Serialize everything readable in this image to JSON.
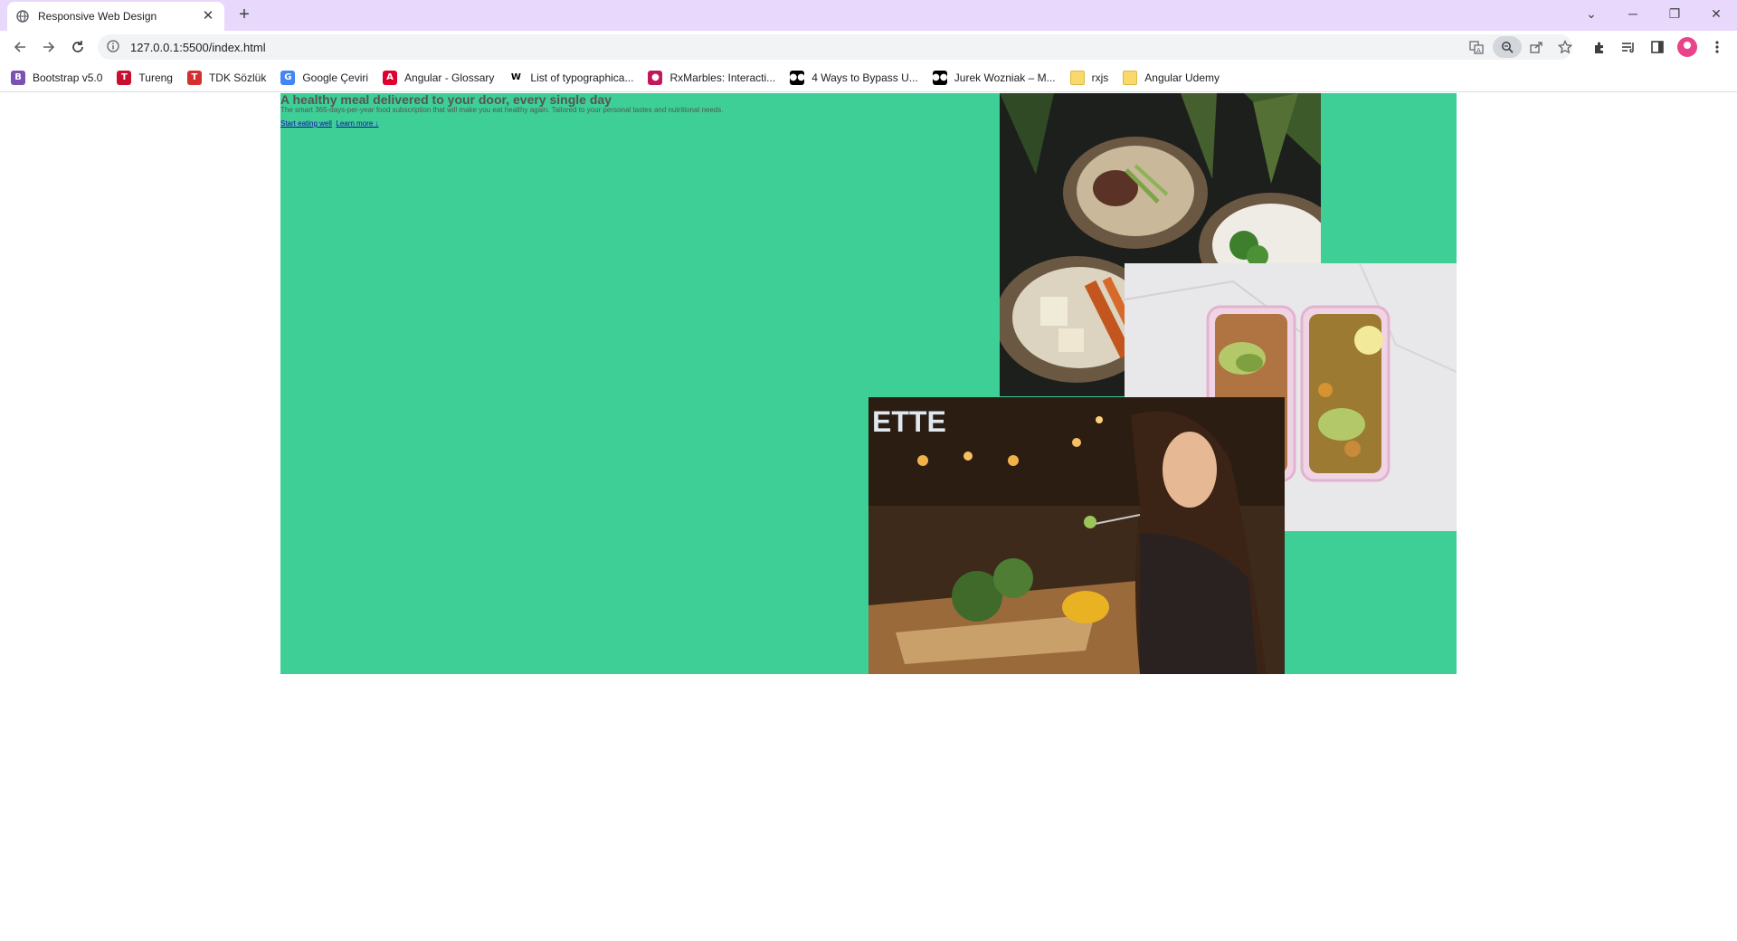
{
  "browser": {
    "tab_title": "Responsive Web Design",
    "url": "127.0.0.1:5500/index.html",
    "bookmarks": [
      {
        "label": "Bootstrap v5.0",
        "icon": "bootstrap-icon",
        "color": "#7952b3",
        "glyph": "B"
      },
      {
        "label": "Tureng",
        "icon": "tureng-icon",
        "color": "#c8102e",
        "glyph": "T"
      },
      {
        "label": "TDK Sözlük",
        "icon": "tdk-icon",
        "color": "#d32f2f",
        "glyph": "T"
      },
      {
        "label": "Google Çeviri",
        "icon": "google-translate-icon",
        "color": "#4285f4",
        "glyph": "G"
      },
      {
        "label": "Angular - Glossary",
        "icon": "angular-icon",
        "color": "#dd0031",
        "glyph": "A"
      },
      {
        "label": "List of typographica...",
        "icon": "wikipedia-icon",
        "color": "#ffffff",
        "glyph": "W"
      },
      {
        "label": "RxMarbles: Interacti...",
        "icon": "rxmarbles-icon",
        "color": "#c2185b",
        "glyph": "●"
      },
      {
        "label": "4 Ways to Bypass U...",
        "icon": "medium-icon",
        "color": "#000000",
        "glyph": "●●"
      },
      {
        "label": "Jurek Wozniak – M...",
        "icon": "medium-icon",
        "color": "#000000",
        "glyph": "●●"
      },
      {
        "label": "rxjs",
        "icon": "folder-icon",
        "color": "#f9d96b",
        "glyph": ""
      },
      {
        "label": "Angular Udemy",
        "icon": "folder-icon",
        "color": "#f9d96b",
        "glyph": ""
      }
    ]
  },
  "hero": {
    "title": "A healthy meal delivered to your door, every single day",
    "description": "The smart 365-days-per-year food subscription that will make you eat healthy again. Tailored to your personal tastes and nutritional needs.",
    "cta_primary": "Start eating well",
    "cta_secondary": "Learn more ↓",
    "background_color": "#3ecf96"
  },
  "images": [
    {
      "name": "food-bowls-image",
      "subject": "bowls of rice, meat and vegetables"
    },
    {
      "name": "meal-prep-boxes-image",
      "subject": "meal prep boxes with chickpeas and avocado"
    },
    {
      "name": "woman-eating-image",
      "subject": "woman eating in a restaurant"
    }
  ]
}
